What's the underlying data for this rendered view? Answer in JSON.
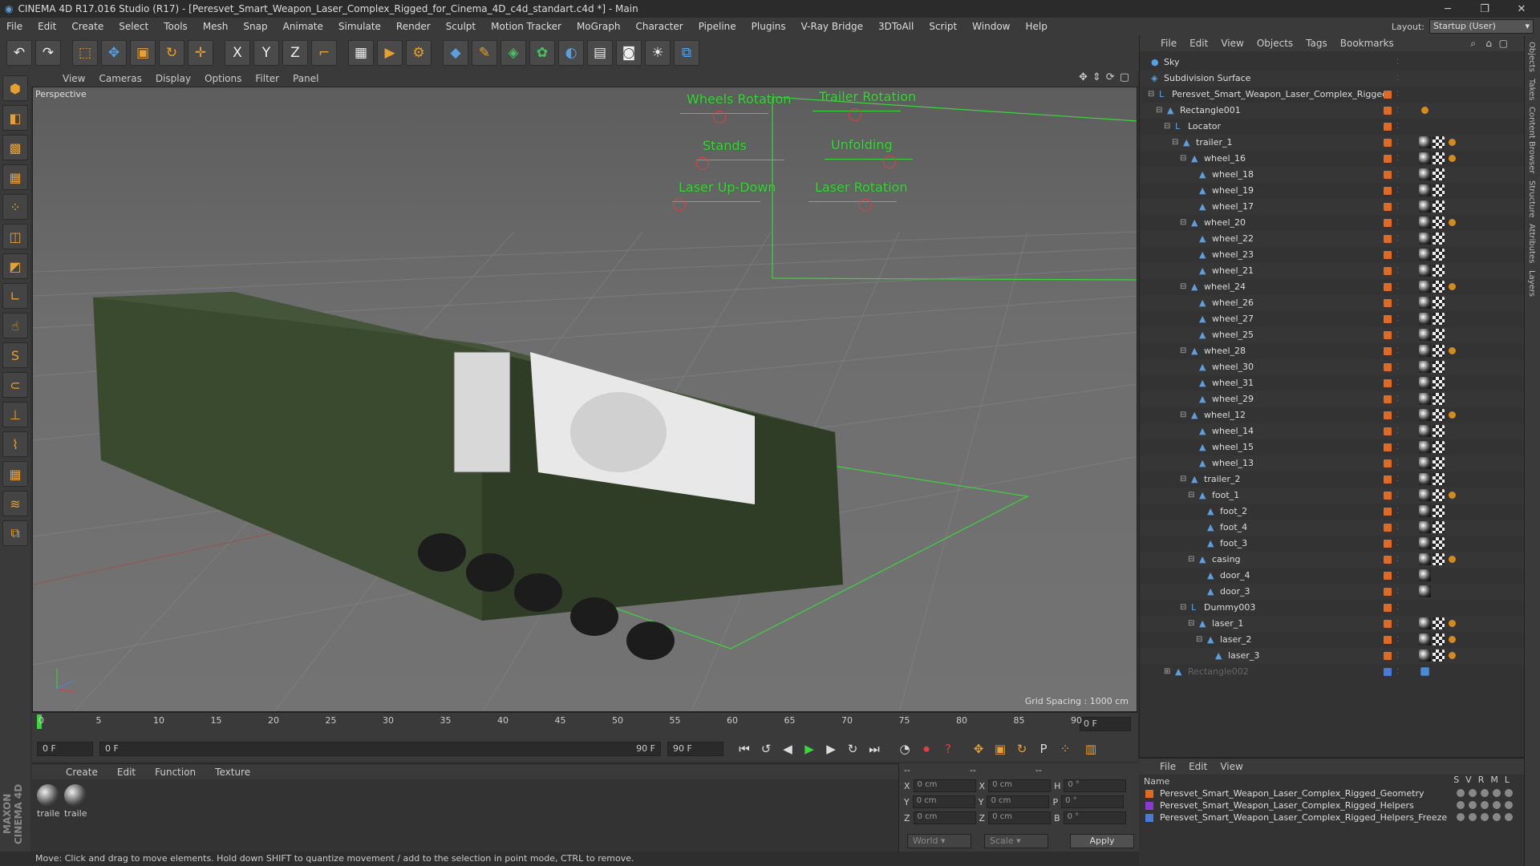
{
  "window": {
    "title": "CINEMA 4D R17.016 Studio (R17) - [Peresvet_Smart_Weapon_Laser_Complex_Rigged_for_Cinema_4D_c4d_standart.c4d *] - Main"
  },
  "menu": [
    "File",
    "Edit",
    "Create",
    "Select",
    "Tools",
    "Mesh",
    "Snap",
    "Animate",
    "Simulate",
    "Render",
    "Sculpt",
    "Motion Tracker",
    "MoGraph",
    "Character",
    "Pipeline",
    "Plugins",
    "V-Ray Bridge",
    "3DToAll",
    "Script",
    "Window",
    "Help"
  ],
  "layout": {
    "label": "Layout:",
    "value": "Startup (User)"
  },
  "toolbar": {
    "icons": [
      {
        "name": "undo-icon",
        "glyph": "↶",
        "c": "white"
      },
      {
        "name": "redo-icon",
        "glyph": "↷",
        "c": "white"
      },
      {
        "name": "live-selection-icon",
        "glyph": "⬚",
        "c": ""
      },
      {
        "name": "move-icon",
        "glyph": "✥",
        "c": "blue"
      },
      {
        "name": "scale-icon",
        "glyph": "▣",
        "c": ""
      },
      {
        "name": "rotate-icon",
        "glyph": "↻",
        "c": ""
      },
      {
        "name": "recent-tool-icon",
        "glyph": "✛",
        "c": ""
      },
      {
        "name": "x-axis-lock-icon",
        "glyph": "X",
        "c": "white"
      },
      {
        "name": "y-axis-lock-icon",
        "glyph": "Y",
        "c": "white"
      },
      {
        "name": "z-axis-lock-icon",
        "glyph": "Z",
        "c": "white"
      },
      {
        "name": "coordinate-system-icon",
        "glyph": "⌐",
        "c": ""
      },
      {
        "name": "render-view-icon",
        "glyph": "▦",
        "c": "white"
      },
      {
        "name": "render-picture-viewer-icon",
        "glyph": "▶",
        "c": ""
      },
      {
        "name": "edit-render-settings-icon",
        "glyph": "⚙",
        "c": ""
      },
      {
        "name": "cube-icon",
        "glyph": "◆",
        "c": "blue"
      },
      {
        "name": "pen-spline-icon",
        "glyph": "✎",
        "c": ""
      },
      {
        "name": "subdivision-surface-icon",
        "glyph": "◈",
        "c": "green"
      },
      {
        "name": "array-icon",
        "glyph": "✿",
        "c": "green"
      },
      {
        "name": "deformer-icon",
        "glyph": "◐",
        "c": "blue"
      },
      {
        "name": "floor-icon",
        "glyph": "▤",
        "c": "white"
      },
      {
        "name": "camera-icon",
        "glyph": "◙",
        "c": "white"
      },
      {
        "name": "light-icon",
        "glyph": "☀",
        "c": "white"
      },
      {
        "name": "python-icon",
        "glyph": "⧉",
        "c": "blue"
      }
    ]
  },
  "lefttools": [
    {
      "name": "make-editable-icon",
      "glyph": "⬢"
    },
    {
      "name": "model-mode-icon",
      "glyph": "◧"
    },
    {
      "name": "texture-mode-icon",
      "glyph": "▩"
    },
    {
      "name": "workplane-mode-icon",
      "glyph": "▦"
    },
    {
      "name": "points-mode-icon",
      "glyph": "⁘"
    },
    {
      "name": "edges-mode-icon",
      "glyph": "◫"
    },
    {
      "name": "polygons-mode-icon",
      "glyph": "◩"
    },
    {
      "name": "axis-mode-icon",
      "glyph": "∟"
    },
    {
      "name": "tweak-mode-icon",
      "glyph": "☝"
    },
    {
      "name": "snap-icon",
      "glyph": "S"
    },
    {
      "name": "magnet-icon",
      "glyph": "⊂"
    },
    {
      "name": "workplane-icon",
      "glyph": "⊥"
    },
    {
      "name": "sculpt-brush-icon",
      "glyph": "⌇"
    },
    {
      "name": "grid-icon",
      "glyph": "▦"
    },
    {
      "name": "layers-icon",
      "glyph": "≋"
    },
    {
      "name": "python-script-icon",
      "glyph": "⧉"
    }
  ],
  "branding": {
    "logo": "MAXON CINEMA 4D"
  },
  "viewport": {
    "menu": [
      "View",
      "Cameras",
      "Display",
      "Options",
      "Filter",
      "Panel"
    ],
    "label": "Perspective",
    "grid_spacing": "Grid Spacing : 1000 cm",
    "controls": [
      "Wheels Rotation",
      "Trailer Rotation",
      "Stands",
      "Unfolding",
      "Laser Up-Down",
      "Laser Rotation"
    ]
  },
  "timeline": {
    "ticks": [
      "0",
      "5",
      "10",
      "15",
      "20",
      "25",
      "30",
      "35",
      "40",
      "45",
      "50",
      "55",
      "60",
      "65",
      "70",
      "75",
      "80",
      "85",
      "90"
    ],
    "current_frame": "0 F"
  },
  "transport": {
    "start": "0 F",
    "range_start": "0 F",
    "range_end": "90 F",
    "end": "90 F"
  },
  "materials": {
    "menu": [
      "Create",
      "Edit",
      "Function",
      "Texture"
    ],
    "items": [
      "traile",
      "traile"
    ]
  },
  "coords": {
    "header": [
      "--",
      "--",
      "--"
    ],
    "rows": [
      {
        "a": "X",
        "v1": "0 cm",
        "b": "X",
        "v2": "0 cm",
        "c": "H",
        "v3": "0 °"
      },
      {
        "a": "Y",
        "v1": "0 cm",
        "b": "Y",
        "v2": "0 cm",
        "c": "P",
        "v3": "0 °"
      },
      {
        "a": "Z",
        "v1": "0 cm",
        "b": "Z",
        "v2": "0 cm",
        "c": "B",
        "v3": "0 °"
      }
    ],
    "space": "World",
    "mode": "Scale",
    "apply": "Apply"
  },
  "status": "Move: Click and drag to move elements. Hold down SHIFT to quantize movement / add to the selection in point mode, CTRL to remove.",
  "object_manager": {
    "menu": [
      "File",
      "Edit",
      "View",
      "Objects",
      "Tags",
      "Bookmarks"
    ],
    "rows": [
      {
        "name": "Sky",
        "d": 0,
        "exp": "",
        "ico": "●",
        "tags": ""
      },
      {
        "name": "Subdivision Surface",
        "d": 0,
        "exp": "",
        "ico": "◈",
        "tags": ""
      },
      {
        "name": "Peresvet_Smart_Weapon_Laser_Complex_Rigged",
        "d": 1,
        "exp": "−",
        "ico": "L",
        "tags": ""
      },
      {
        "name": "Rectangle001",
        "d": 2,
        "exp": "−",
        "ico": "▲",
        "tags": "d"
      },
      {
        "name": "Locator",
        "d": 3,
        "exp": "−",
        "ico": "L",
        "tags": ""
      },
      {
        "name": "trailer_1",
        "d": 4,
        "exp": "−",
        "ico": "▲",
        "tags": "bcd"
      },
      {
        "name": "wheel_16",
        "d": 5,
        "exp": "−",
        "ico": "▲",
        "tags": "bcd"
      },
      {
        "name": "wheel_18",
        "d": 6,
        "exp": "",
        "ico": "▲",
        "tags": "bc"
      },
      {
        "name": "wheel_19",
        "d": 6,
        "exp": "",
        "ico": "▲",
        "tags": "bc"
      },
      {
        "name": "wheel_17",
        "d": 6,
        "exp": "",
        "ico": "▲",
        "tags": "bc"
      },
      {
        "name": "wheel_20",
        "d": 5,
        "exp": "−",
        "ico": "▲",
        "tags": "bcd"
      },
      {
        "name": "wheel_22",
        "d": 6,
        "exp": "",
        "ico": "▲",
        "tags": "bc"
      },
      {
        "name": "wheel_23",
        "d": 6,
        "exp": "",
        "ico": "▲",
        "tags": "bc"
      },
      {
        "name": "wheel_21",
        "d": 6,
        "exp": "",
        "ico": "▲",
        "tags": "bc"
      },
      {
        "name": "wheel_24",
        "d": 5,
        "exp": "−",
        "ico": "▲",
        "tags": "bcd"
      },
      {
        "name": "wheel_26",
        "d": 6,
        "exp": "",
        "ico": "▲",
        "tags": "bc"
      },
      {
        "name": "wheel_27",
        "d": 6,
        "exp": "",
        "ico": "▲",
        "tags": "bc"
      },
      {
        "name": "wheel_25",
        "d": 6,
        "exp": "",
        "ico": "▲",
        "tags": "bc"
      },
      {
        "name": "wheel_28",
        "d": 5,
        "exp": "−",
        "ico": "▲",
        "tags": "bcd"
      },
      {
        "name": "wheel_30",
        "d": 6,
        "exp": "",
        "ico": "▲",
        "tags": "bc"
      },
      {
        "name": "wheel_31",
        "d": 6,
        "exp": "",
        "ico": "▲",
        "tags": "bc"
      },
      {
        "name": "wheel_29",
        "d": 6,
        "exp": "",
        "ico": "▲",
        "tags": "bc"
      },
      {
        "name": "wheel_12",
        "d": 5,
        "exp": "−",
        "ico": "▲",
        "tags": "bcd"
      },
      {
        "name": "wheel_14",
        "d": 6,
        "exp": "",
        "ico": "▲",
        "tags": "bc"
      },
      {
        "name": "wheel_15",
        "d": 6,
        "exp": "",
        "ico": "▲",
        "tags": "bc"
      },
      {
        "name": "wheel_13",
        "d": 6,
        "exp": "",
        "ico": "▲",
        "tags": "bc"
      },
      {
        "name": "trailer_2",
        "d": 5,
        "exp": "−",
        "ico": "▲",
        "tags": "bc"
      },
      {
        "name": "foot_1",
        "d": 6,
        "exp": "−",
        "ico": "▲",
        "tags": "bcd"
      },
      {
        "name": "foot_2",
        "d": 7,
        "exp": "",
        "ico": "▲",
        "tags": "bc"
      },
      {
        "name": "foot_4",
        "d": 7,
        "exp": "",
        "ico": "▲",
        "tags": "bc"
      },
      {
        "name": "foot_3",
        "d": 7,
        "exp": "",
        "ico": "▲",
        "tags": "bc"
      },
      {
        "name": "casing",
        "d": 6,
        "exp": "−",
        "ico": "▲",
        "tags": "bcd"
      },
      {
        "name": "door_4",
        "d": 7,
        "exp": "",
        "ico": "▲",
        "tags": "b"
      },
      {
        "name": "door_3",
        "d": 7,
        "exp": "",
        "ico": "▲",
        "tags": "b"
      },
      {
        "name": "Dummy003",
        "d": 5,
        "exp": "−",
        "ico": "L",
        "tags": ""
      },
      {
        "name": "laser_1",
        "d": 6,
        "exp": "−",
        "ico": "▲",
        "tags": "bcd"
      },
      {
        "name": "laser_2",
        "d": 7,
        "exp": "−",
        "ico": "▲",
        "tags": "bcd"
      },
      {
        "name": "laser_3",
        "d": 8,
        "exp": "",
        "ico": "▲",
        "tags": "bcd"
      },
      {
        "name": "Rectangle002",
        "d": 3,
        "exp": "+",
        "ico": "▲",
        "tags": "e"
      }
    ]
  },
  "layer_manager": {
    "menu": [
      "File",
      "Edit",
      "View"
    ],
    "col_name": "Name",
    "flags": [
      "S",
      "V",
      "R",
      "M",
      "L"
    ],
    "layers": [
      {
        "name": "Peresvet_Smart_Weapon_Laser_Complex_Rigged_Geometry",
        "color": "#e06a20"
      },
      {
        "name": "Peresvet_Smart_Weapon_Laser_Complex_Rigged_Helpers",
        "color": "#8a3ad0"
      },
      {
        "name": "Peresvet_Smart_Weapon_Laser_Complex_Rigged_Helpers_Freeze",
        "color": "#4a7ad8"
      }
    ]
  },
  "right_tabs": [
    "Objects",
    "Takes",
    "Content Browser",
    "Structure",
    "Attributes",
    "Layers"
  ]
}
